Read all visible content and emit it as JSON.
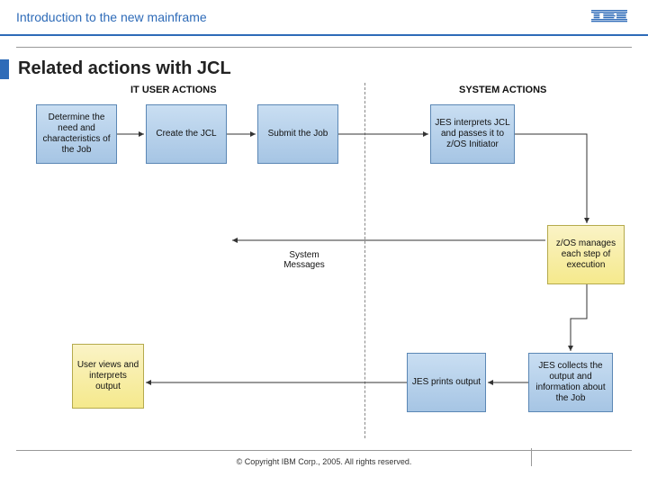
{
  "header": {
    "title": "Introduction to the new mainframe",
    "logo": "IBM"
  },
  "slide": {
    "title": "Related actions with JCL"
  },
  "columns": {
    "user": "IT USER ACTIONS",
    "system": "SYSTEM ACTIONS"
  },
  "boxes": {
    "b1": "Determine the need and characteristics of the Job",
    "b2": "Create the JCL",
    "b3": "Submit the Job",
    "b4": "JES interprets JCL and passes it to z/OS Initiator",
    "b5": "z/OS manages each step of execution",
    "b6": "JES collects the output and information about the Job",
    "b7": "JES prints output",
    "b8": "User views and interprets output"
  },
  "labels": {
    "sysmsg": "System Messages"
  },
  "footer": {
    "copyright": "© Copyright IBM Corp., 2005. All rights reserved."
  }
}
